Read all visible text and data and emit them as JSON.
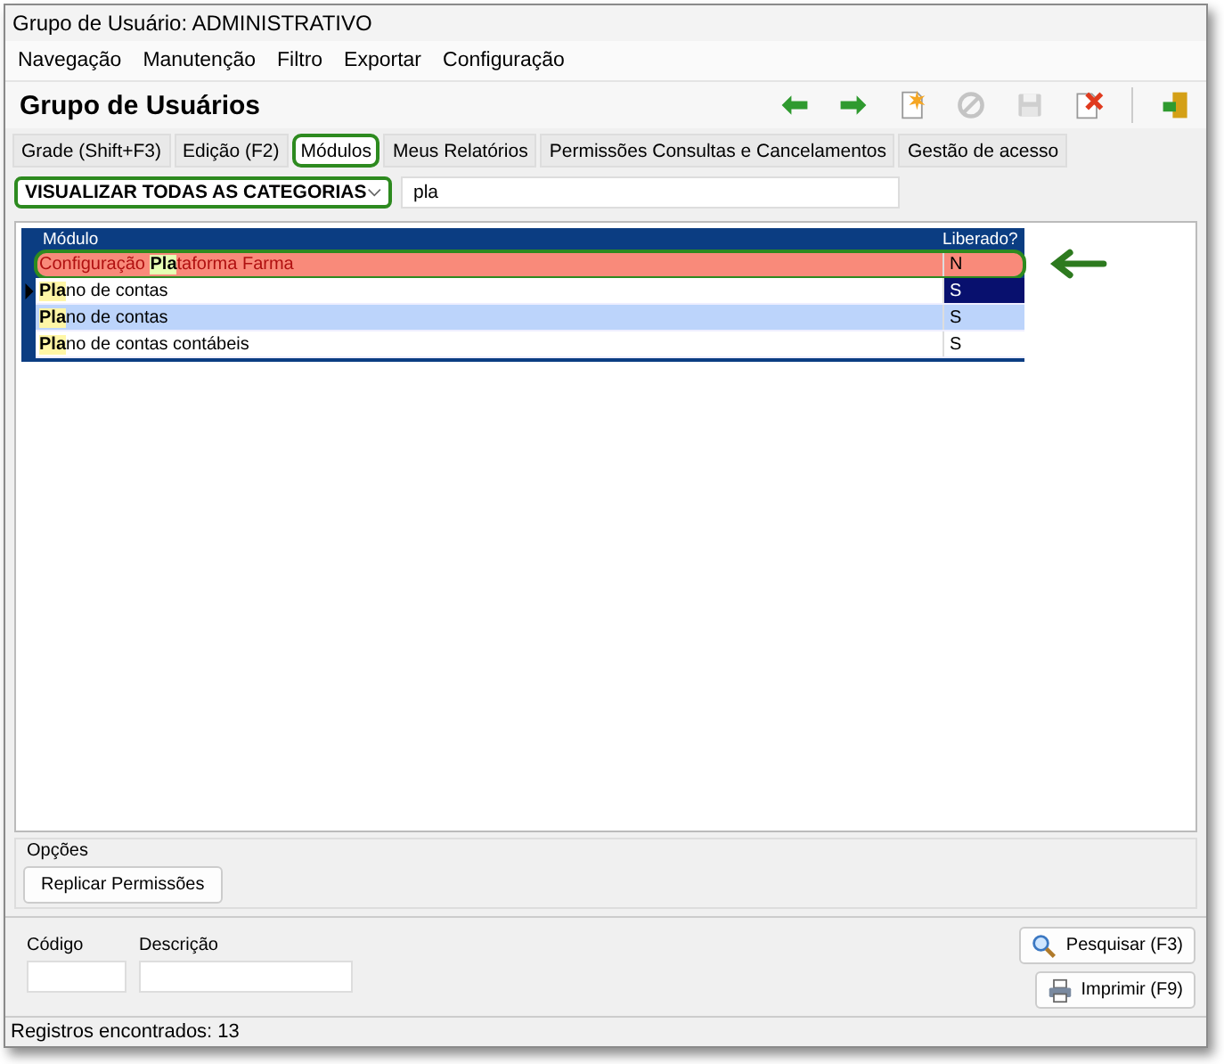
{
  "window": {
    "title": "Grupo de Usuário: ADMINISTRATIVO"
  },
  "menu": [
    "Navegação",
    "Manutenção",
    "Filtro",
    "Exportar",
    "Configuração"
  ],
  "header": {
    "title": "Grupo de Usuários"
  },
  "toolbar": [
    {
      "kind": "back",
      "disabled": false
    },
    {
      "kind": "forward",
      "disabled": false
    },
    {
      "kind": "new",
      "disabled": false
    },
    {
      "kind": "cancel",
      "disabled": true
    },
    {
      "kind": "save",
      "disabled": true
    },
    {
      "kind": "delete",
      "disabled": false
    },
    {
      "kind": "exit",
      "disabled": false
    }
  ],
  "tabs": [
    {
      "label": "Grade (Shift+F3)",
      "selected": false,
      "annotated": false
    },
    {
      "label": "Edição (F2)",
      "selected": false,
      "annotated": false
    },
    {
      "label": "Módulos",
      "selected": true,
      "annotated": true
    },
    {
      "label": "Meus Relatórios",
      "selected": false,
      "annotated": false
    },
    {
      "label": "Permissões Consultas e Cancelamentos",
      "selected": false,
      "annotated": false
    },
    {
      "label": "Gestão de acesso",
      "selected": false,
      "annotated": false
    }
  ],
  "filter": {
    "category": "VISUALIZAR TODAS AS CATEGORIAS",
    "annotated": true,
    "search": "pla"
  },
  "table": {
    "columns": [
      "Módulo",
      "Liberado?"
    ],
    "rows": [
      {
        "module": "Configuração **Pla**taforma Farma",
        "liberado": "N",
        "color": "#f98a7a",
        "current": false,
        "annotated": true
      },
      {
        "module": "**Pla**no de contas",
        "liberado": "S",
        "color": "#ffffff",
        "current": true,
        "annotated": false
      },
      {
        "module": "**Pla**no de contas",
        "liberado": "S",
        "color": "#bcd4fb",
        "current": false,
        "annotated": false
      },
      {
        "module": "**Pla**no de contas contábeis",
        "liberado": "S",
        "color": "#ffffff",
        "current": false,
        "annotated": false
      }
    ]
  },
  "options": {
    "title": "Opções",
    "button": "Replicar Permissões"
  },
  "search_panel": {
    "fields": [
      {
        "label": "Código"
      },
      {
        "label": "Descrição"
      }
    ],
    "buttons": [
      {
        "kind": "search",
        "label": "Pesquisar (F3)"
      },
      {
        "kind": "print",
        "label": "Imprimir (F9)"
      }
    ]
  },
  "status_bar": "Registros encontrados: 13"
}
